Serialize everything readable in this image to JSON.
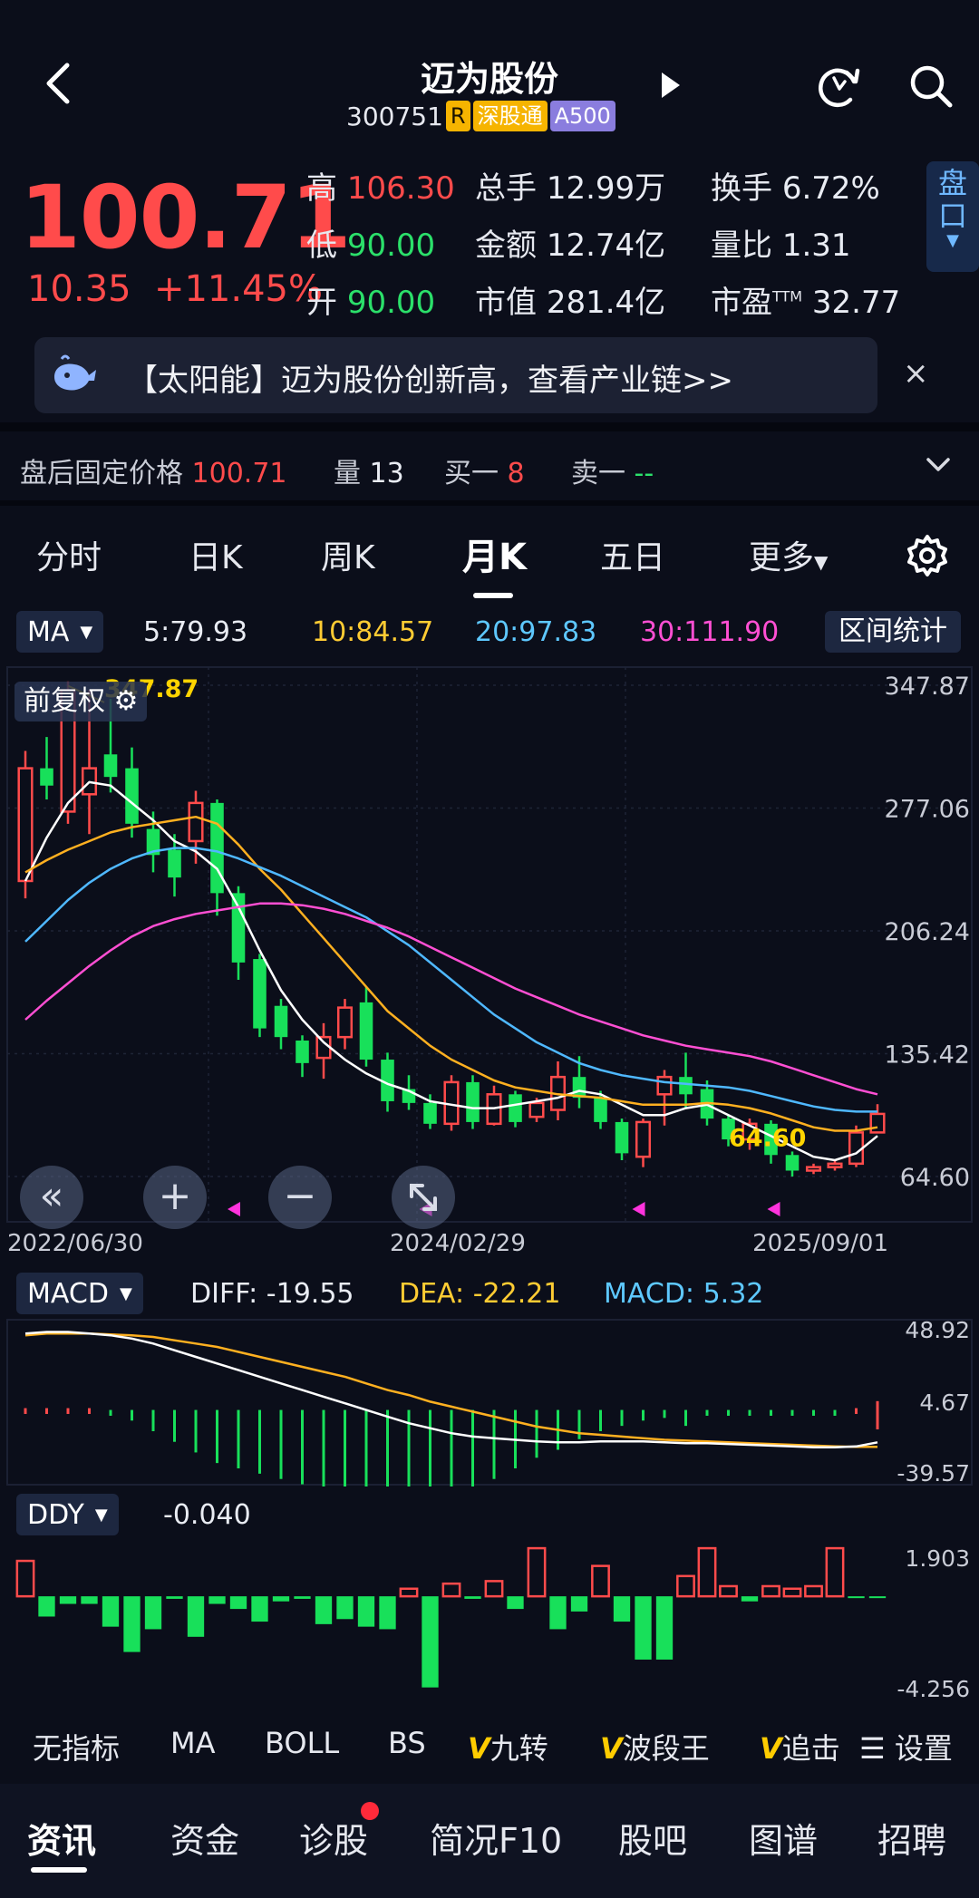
{
  "header": {
    "title": "迈为股份",
    "code": "300751",
    "badges": [
      "R",
      "深股通",
      "A500"
    ]
  },
  "quote": {
    "price": "100.71",
    "change": "10.35",
    "change_pct": "+11.45%",
    "stats": {
      "high_label": "高",
      "high": "106.30",
      "low_label": "低",
      "low": "90.00",
      "open_label": "开",
      "open": "90.00",
      "volume_label": "总手",
      "volume": "12.99万",
      "amount_label": "金额",
      "amount": "12.74亿",
      "mcap_label": "市值",
      "mcap": "281.4亿",
      "turnover_label": "换手",
      "turnover": "6.72%",
      "vol_ratio_label": "量比",
      "vol_ratio": "1.31",
      "pe_label": "市盈",
      "pe_sup": "TTM",
      "pe": "32.77"
    },
    "pankou_label": [
      "盘",
      "口"
    ]
  },
  "news": {
    "text": "【太阳能】迈为股份创新高，查看产业链>>",
    "close": "×"
  },
  "after_hours": {
    "label": "盘后固定价格",
    "price": "100.71",
    "vol_label": "量",
    "vol": "13",
    "bid_label": "买一",
    "bid": "8",
    "ask_label": "卖一",
    "ask": "--"
  },
  "period_tabs": [
    "分时",
    "日K",
    "周K",
    "月K",
    "五日",
    "更多"
  ],
  "ma_bar": {
    "selector": "MA",
    "ma5": "5:79.93",
    "ma10": "10:84.57",
    "ma20": "20:97.83",
    "ma30": "30:111.90",
    "range_button": "区间统计"
  },
  "chart_controls": {
    "fuquan": "前复权",
    "rewind": "«",
    "zoom_in": "+",
    "zoom_out": "−"
  },
  "chart_data": {
    "type": "candlestick",
    "ylim": [
      64.6,
      347.87
    ],
    "y_ticks": [
      "347.87",
      "277.06",
      "206.24",
      "135.42",
      "64.60"
    ],
    "x_labels": [
      "2022/06/30",
      "2024/02/29",
      "2025/09/01"
    ],
    "max_label": "347.87",
    "min_label": "64.60",
    "candles": [
      {
        "o": 235,
        "c": 300,
        "h": 310,
        "l": 225
      },
      {
        "o": 300,
        "c": 290,
        "h": 318,
        "l": 282
      },
      {
        "o": 275,
        "c": 345,
        "h": 350,
        "l": 268
      },
      {
        "o": 285,
        "c": 300,
        "h": 345,
        "l": 262
      },
      {
        "o": 308,
        "c": 295,
        "h": 340,
        "l": 286
      },
      {
        "o": 300,
        "c": 268,
        "h": 312,
        "l": 260
      },
      {
        "o": 265,
        "c": 250,
        "h": 275,
        "l": 240
      },
      {
        "o": 253,
        "c": 237,
        "h": 262,
        "l": 226
      },
      {
        "o": 258,
        "c": 280,
        "h": 287,
        "l": 245
      },
      {
        "o": 280,
        "c": 228,
        "h": 282,
        "l": 215
      },
      {
        "o": 228,
        "c": 188,
        "h": 232,
        "l": 178
      },
      {
        "o": 190,
        "c": 150,
        "h": 193,
        "l": 145
      },
      {
        "o": 163,
        "c": 145,
        "h": 167,
        "l": 138
      },
      {
        "o": 143,
        "c": 130,
        "h": 146,
        "l": 122
      },
      {
        "o": 133,
        "c": 145,
        "h": 153,
        "l": 121
      },
      {
        "o": 145,
        "c": 162,
        "h": 167,
        "l": 138
      },
      {
        "o": 165,
        "c": 132,
        "h": 174,
        "l": 128
      },
      {
        "o": 132,
        "c": 108,
        "h": 136,
        "l": 102
      },
      {
        "o": 115,
        "c": 107,
        "h": 123,
        "l": 103
      },
      {
        "o": 107,
        "c": 95,
        "h": 112,
        "l": 92
      },
      {
        "o": 95,
        "c": 119,
        "h": 123,
        "l": 91
      },
      {
        "o": 119,
        "c": 96,
        "h": 123,
        "l": 92
      },
      {
        "o": 95,
        "c": 112,
        "h": 117,
        "l": 94
      },
      {
        "o": 112,
        "c": 96,
        "h": 114,
        "l": 93
      },
      {
        "o": 99,
        "c": 107,
        "h": 110,
        "l": 96
      },
      {
        "o": 103,
        "c": 122,
        "h": 131,
        "l": 97
      },
      {
        "o": 122,
        "c": 110,
        "h": 134,
        "l": 104
      },
      {
        "o": 110,
        "c": 96,
        "h": 114,
        "l": 92
      },
      {
        "o": 96,
        "c": 78,
        "h": 98,
        "l": 74
      },
      {
        "o": 76,
        "c": 96,
        "h": 98,
        "l": 70
      },
      {
        "o": 112,
        "c": 122,
        "h": 126,
        "l": 94
      },
      {
        "o": 122,
        "c": 112,
        "h": 136,
        "l": 104
      },
      {
        "o": 115,
        "c": 98,
        "h": 120,
        "l": 94
      },
      {
        "o": 98,
        "c": 86,
        "h": 100,
        "l": 82
      },
      {
        "o": 86,
        "c": 95,
        "h": 98,
        "l": 80
      },
      {
        "o": 95,
        "c": 77,
        "h": 97,
        "l": 72
      },
      {
        "o": 77,
        "c": 68,
        "h": 79,
        "l": 64.6
      },
      {
        "o": 68,
        "c": 70,
        "h": 72,
        "l": 66
      },
      {
        "o": 70,
        "c": 72,
        "h": 74,
        "l": 68
      },
      {
        "o": 72,
        "c": 90,
        "h": 94,
        "l": 70
      },
      {
        "o": 90,
        "c": 100.71,
        "h": 106.3,
        "l": 90
      }
    ],
    "series": [
      {
        "name": "5",
        "color": "#ffffff",
        "values": [
          235,
          260,
          280,
          292,
          290,
          280,
          270,
          258,
          252,
          242,
          220,
          195,
          172,
          155,
          142,
          132,
          124,
          118,
          114,
          108,
          106,
          104,
          104,
          106,
          108,
          110,
          114,
          112,
          106,
          100,
          100,
          104,
          106,
          100,
          94,
          88,
          82,
          76,
          74,
          78,
          88
        ]
      },
      {
        "name": "10",
        "color": "#ffb020",
        "values": [
          240,
          247,
          253,
          258,
          263,
          266,
          268,
          270,
          272,
          268,
          256,
          242,
          230,
          216,
          202,
          188,
          174,
          160,
          150,
          140,
          132,
          126,
          120,
          116,
          114,
          112,
          111,
          110,
          108,
          106,
          106,
          106,
          107,
          106,
          104,
          101,
          97,
          93,
          91,
          91,
          93
        ]
      },
      {
        "name": "20",
        "color": "#4fb8ff",
        "values": [
          200,
          212,
          224,
          234,
          242,
          248,
          252,
          254,
          254,
          252,
          248,
          243,
          238,
          232,
          226,
          220,
          214,
          206,
          198,
          188,
          178,
          168,
          158,
          150,
          142,
          136,
          130,
          126,
          123,
          121,
          119,
          118,
          117,
          116,
          114,
          111,
          108,
          105,
          103,
          102,
          102
        ]
      },
      {
        "name": "30",
        "color": "#ff4fd3",
        "values": [
          155,
          166,
          176,
          186,
          195,
          203,
          209,
          213,
          216,
          218,
          220,
          222,
          222,
          221,
          219,
          216,
          212,
          208,
          203,
          197,
          191,
          185,
          179,
          173,
          168,
          163,
          158,
          154,
          150,
          146,
          143,
          140,
          138,
          136,
          134,
          131,
          127,
          123,
          119,
          115,
          112
        ]
      }
    ],
    "macd": {
      "selector": "MACD",
      "diff_label": "DIFF:",
      "diff": "-19.55",
      "dea_label": "DEA:",
      "dea": "-22.21",
      "macd_label": "MACD:",
      "macd": "5.32",
      "ticks": [
        "48.92",
        "4.67",
        "-39.57"
      ],
      "ylim": [
        -39.57,
        48.92
      ],
      "diff_values": [
        46,
        47,
        47,
        46,
        45,
        43,
        40,
        36,
        32,
        28,
        24,
        20,
        16,
        12,
        8,
        4,
        0,
        -4,
        -8,
        -11,
        -14,
        -16,
        -17,
        -18,
        -19,
        -19.5,
        -19.5,
        -19,
        -19,
        -19,
        -19.5,
        -20,
        -20,
        -20.5,
        -21,
        -21.5,
        -22,
        -22.5,
        -22.5,
        -22,
        -19.55
      ],
      "dea_values": [
        45,
        46,
        46,
        46,
        45.5,
        45,
        44,
        42,
        40,
        38,
        35,
        32,
        29,
        26,
        23,
        20,
        16,
        12,
        9,
        5,
        2,
        -1,
        -4,
        -7,
        -10,
        -12,
        -14,
        -15,
        -16,
        -17,
        -18,
        -18.5,
        -19,
        -19.5,
        -20,
        -20.5,
        -21,
        -21.5,
        -22,
        -22.2,
        -22.21
      ],
      "hist_values": [
        1,
        1,
        1,
        0,
        -0.5,
        -2,
        -4,
        -6,
        -8,
        -10,
        -11,
        -12,
        -13,
        -14,
        -15,
        -16,
        -16,
        -16,
        -17,
        -16,
        -16,
        -15,
        -13,
        -11,
        -9,
        -7.5,
        -5.5,
        -4,
        -3,
        -2,
        -1.5,
        -3,
        -1,
        -1,
        -1,
        -1,
        -1,
        -1,
        -0.5,
        0.2,
        5.32
      ]
    },
    "ddy": {
      "selector": "DDY",
      "value": "-0.040",
      "ticks": [
        "1.903",
        "-4.256"
      ],
      "ylim": [
        -4.256,
        1.903
      ],
      "values": [
        1.4,
        -0.8,
        -0.3,
        -0.3,
        -1.2,
        -2.2,
        -1.3,
        -0.1,
        -1.6,
        -0.3,
        -0.5,
        -1.0,
        -0.2,
        -0.1,
        -1.1,
        -0.9,
        -1.2,
        -1.3,
        0.3,
        -3.6,
        0.5,
        -0.1,
        0.6,
        -0.5,
        1.9,
        -1.3,
        -0.6,
        1.2,
        -1.0,
        -2.5,
        -2.5,
        0.8,
        1.9,
        0.4,
        -0.2,
        0.4,
        0.3,
        0.4,
        1.9,
        -0.04,
        -0.04
      ]
    }
  },
  "indicator_tabs": [
    "无指标",
    "MA",
    "BOLL",
    "BS",
    "九转",
    "波段王",
    "追击",
    "设置"
  ],
  "bottom_nav": [
    "资讯",
    "资金",
    "诊股",
    "简况F10",
    "股吧",
    "图谱",
    "招聘"
  ]
}
